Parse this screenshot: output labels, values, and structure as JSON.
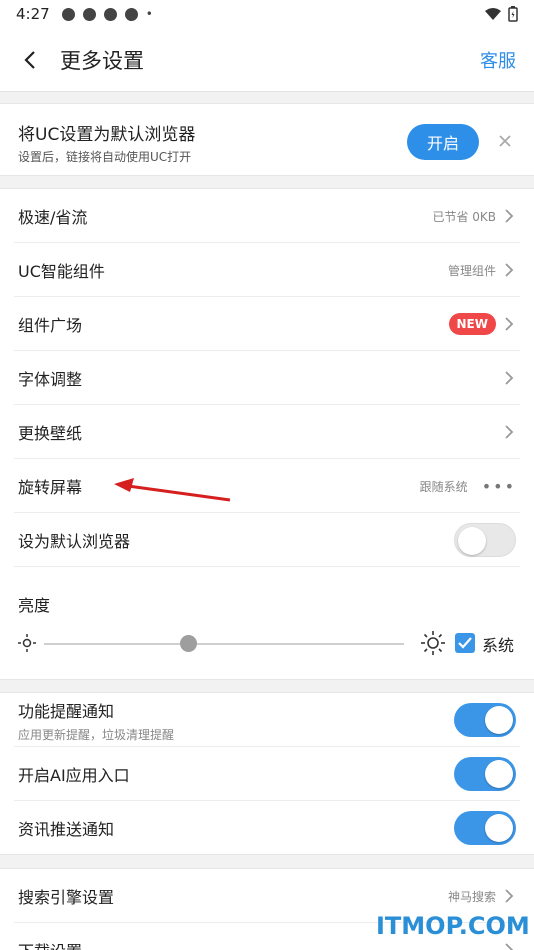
{
  "status_bar": {
    "time": "4:27",
    "bullet": "•"
  },
  "header": {
    "back_icon": "chevron-left-icon",
    "title": "更多设置",
    "service_label": "客服"
  },
  "default_browser_banner": {
    "title": "将UC设置为默认浏览器",
    "subtitle": "设置后，链接将自动使用UC打开",
    "enable_label": "开启",
    "close_icon": "close-icon"
  },
  "settings_group_1": {
    "rows": [
      {
        "label": "极速/省流",
        "value": "已节省 0KB"
      },
      {
        "label": "UC智能组件",
        "value": "管理组件"
      },
      {
        "label": "组件广场",
        "badge": "NEW"
      },
      {
        "label": "字体调整"
      },
      {
        "label": "更换壁纸"
      },
      {
        "label": "旋转屏幕",
        "value": "跟随系统",
        "more": "•••"
      },
      {
        "label": "设为默认浏览器",
        "toggle": false
      }
    ],
    "brightness": {
      "label": "亮度",
      "level": 0.4,
      "system_checked": true,
      "system_label": "系统"
    }
  },
  "settings_group_2": {
    "rows": [
      {
        "label": "功能提醒通知",
        "sub": "应用更新提醒，垃圾清理提醒",
        "toggle": true
      },
      {
        "label": "开启AI应用入口",
        "toggle": true
      },
      {
        "label": "资讯推送通知",
        "toggle": true
      }
    ]
  },
  "settings_group_3": {
    "rows": [
      {
        "label": "搜索引擎设置",
        "value": "神马搜索"
      },
      {
        "label": "下载设置"
      }
    ]
  },
  "watermark": "ITMOP.COM",
  "colors": {
    "accent": "#2e8fe8",
    "badge": "#f04848",
    "annotation_arrow": "#d62020"
  }
}
